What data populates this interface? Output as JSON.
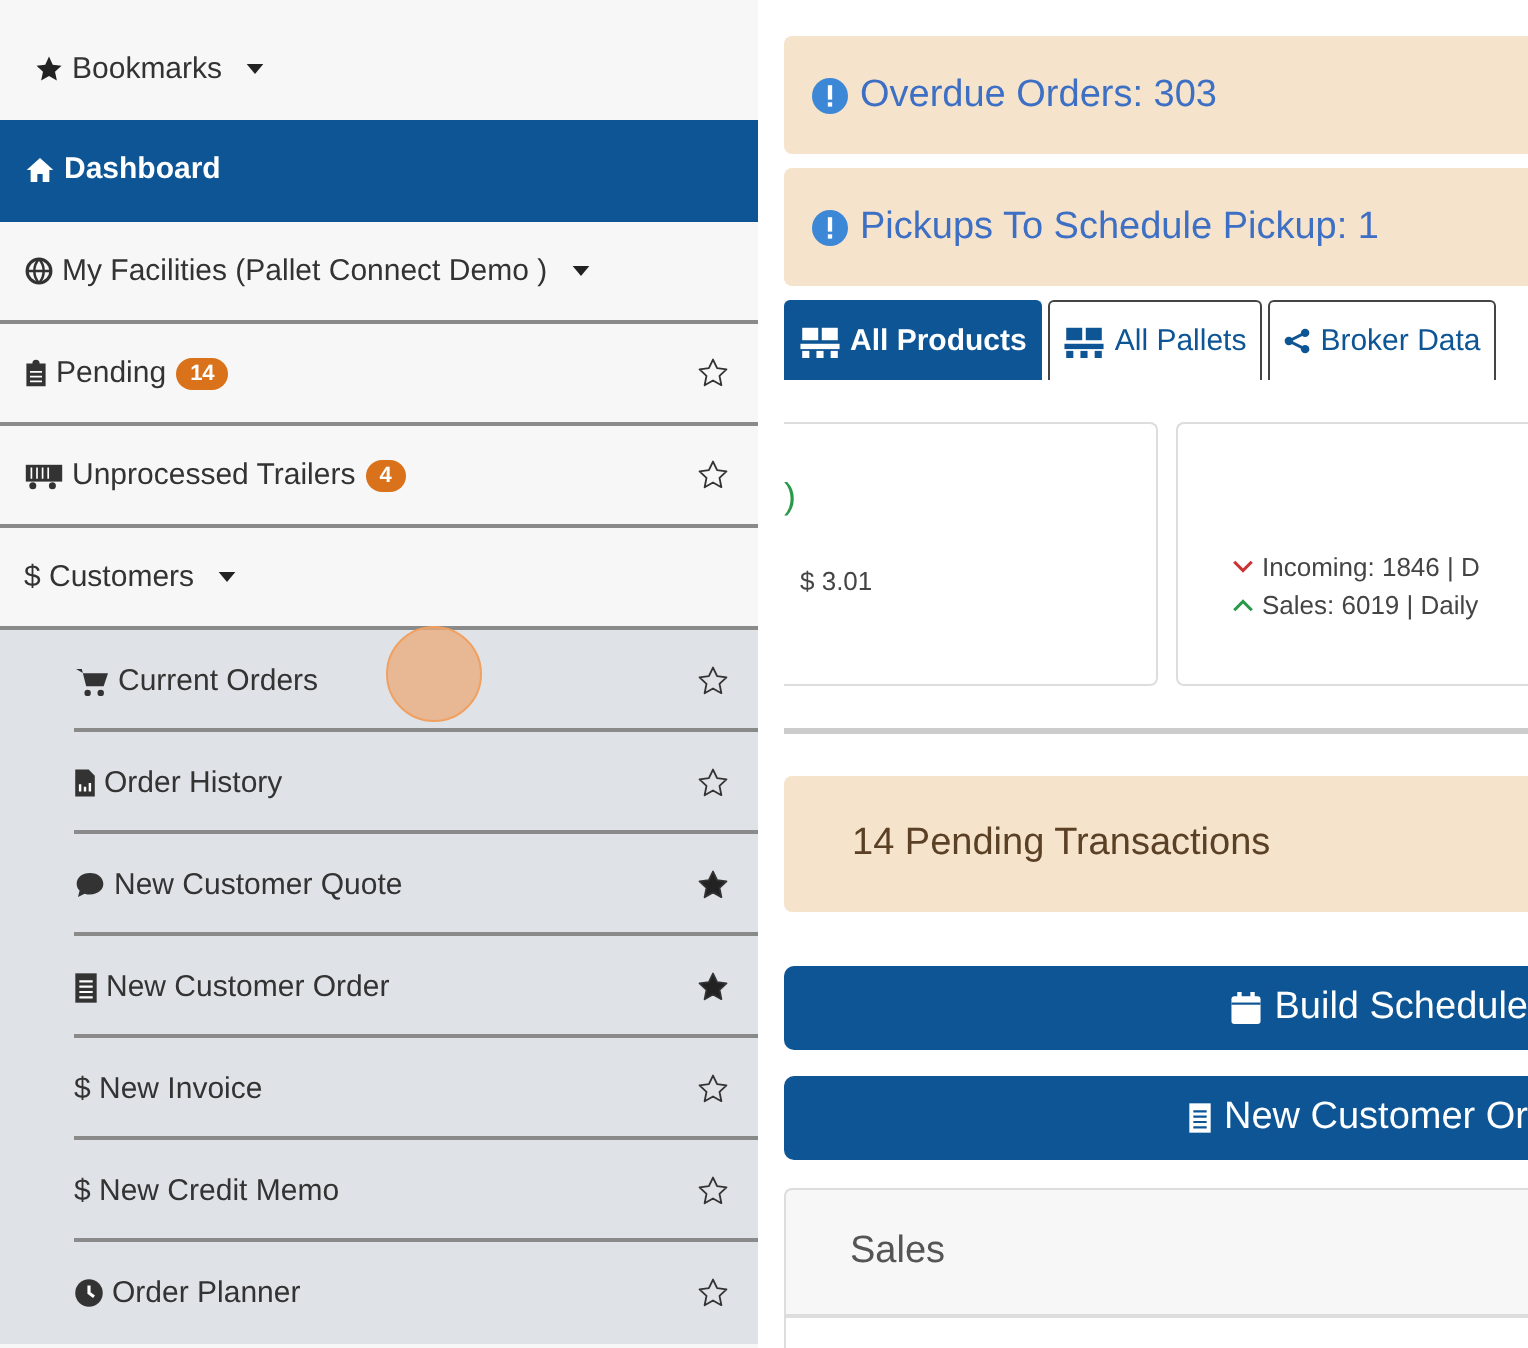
{
  "sidebar": {
    "items": [
      {
        "kind": "dropdown",
        "label": "Bookmarks",
        "selected": false
      },
      {
        "kind": "link",
        "label": "Dashboard",
        "selected": true
      },
      {
        "kind": "dropdown",
        "label": "My Facilities (Pallet Connect Demo )",
        "selected": false
      },
      {
        "kind": "favorite",
        "label": "Pending",
        "badge": "14",
        "starred": false,
        "selected": false
      },
      {
        "kind": "favorite",
        "label": "Unprocessed Trailers",
        "badge": "4",
        "starred": false,
        "selected": false
      },
      {
        "kind": "dropdown",
        "label": "$ Customers",
        "selected": false,
        "children": [
          {
            "label": "Current Orders",
            "starred": false,
            "selected": false
          },
          {
            "label": "Order History",
            "starred": false,
            "selected": false
          },
          {
            "label": "New Customer Quote",
            "starred": true,
            "selected": false
          },
          {
            "label": "New Customer Order",
            "starred": true,
            "selected": false
          },
          {
            "label": "$ New Invoice",
            "starred": false,
            "selected": false
          },
          {
            "label": "$ New Credit Memo",
            "starred": false,
            "selected": false
          },
          {
            "label": "Order Planner",
            "starred": false,
            "selected": false
          }
        ]
      }
    ]
  },
  "alerts": [
    {
      "text": "Overdue Orders: 303"
    },
    {
      "text": "Pickups To Schedule Pickup: 1"
    }
  ],
  "tabs": [
    {
      "label": "All Products",
      "selected": true
    },
    {
      "label": "All Pallets",
      "selected": false
    },
    {
      "label": "Broker Data",
      "selected": false
    }
  ],
  "cards": [
    {
      "kind": "price",
      "fragment": ")",
      "price": "$ 3.01"
    },
    {
      "kind": "trends",
      "trends": [
        {
          "kind": "down",
          "text": "Incoming: 1846 | D"
        },
        {
          "kind": "up",
          "text": "Sales: 6019 | Daily"
        }
      ]
    }
  ],
  "pending_alert": {
    "text": "14 Pending Transactions"
  },
  "buttons": [
    {
      "label": "Build Schedule"
    },
    {
      "label": "New Customer Or"
    }
  ],
  "panel": {
    "title": "Sales"
  }
}
